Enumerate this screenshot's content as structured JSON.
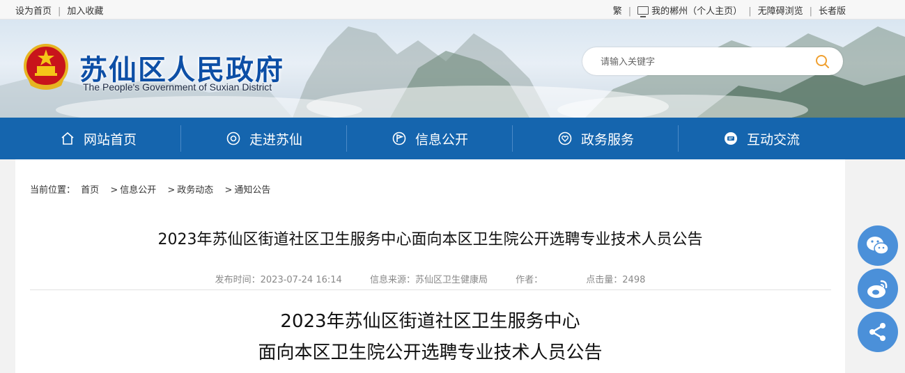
{
  "topbar": {
    "set_home": "设为首页",
    "bookmark": "加入收藏",
    "traditional": "繁",
    "my_city": "我的郴州（个人主页）",
    "accessible": "无障碍浏览",
    "elder": "长者版"
  },
  "header": {
    "title": "苏仙区人民政府",
    "subtitle": "The People's Government of Suxian District",
    "search_placeholder": "请输入关键字"
  },
  "nav": {
    "items": [
      {
        "label": "网站首页",
        "icon": "home-icon"
      },
      {
        "label": "走进苏仙",
        "icon": "target-icon"
      },
      {
        "label": "信息公开",
        "icon": "flag-icon"
      },
      {
        "label": "政务服务",
        "icon": "heart-icon"
      },
      {
        "label": "互动交流",
        "icon": "chat-icon"
      }
    ]
  },
  "breadcrumb": {
    "prefix": "当前位置：",
    "items": [
      "首页",
      "信息公开",
      "政务动态",
      "通知公告"
    ]
  },
  "article": {
    "title": "2023年苏仙区街道社区卫生服务中心面向本区卫生院公开选聘专业技术人员公告",
    "publish_time_label": "发布时间：",
    "publish_time": "2023-07-24 16:14",
    "source_label": "信息来源：",
    "source": "苏仙区卫生健康局",
    "author_label": "作者：",
    "author": "",
    "hits_label": "点击量：",
    "hits": "2498",
    "body_title_line1": "2023年苏仙区街道社区卫生服务中心",
    "body_title_line2": "面向本区卫生院公开选聘专业技术人员公告"
  },
  "share": [
    "wechat-icon",
    "weibo-icon",
    "share-icon"
  ],
  "colors": {
    "nav": "#1565ae",
    "title": "#0d4fa6",
    "share": "#4b90d9"
  }
}
